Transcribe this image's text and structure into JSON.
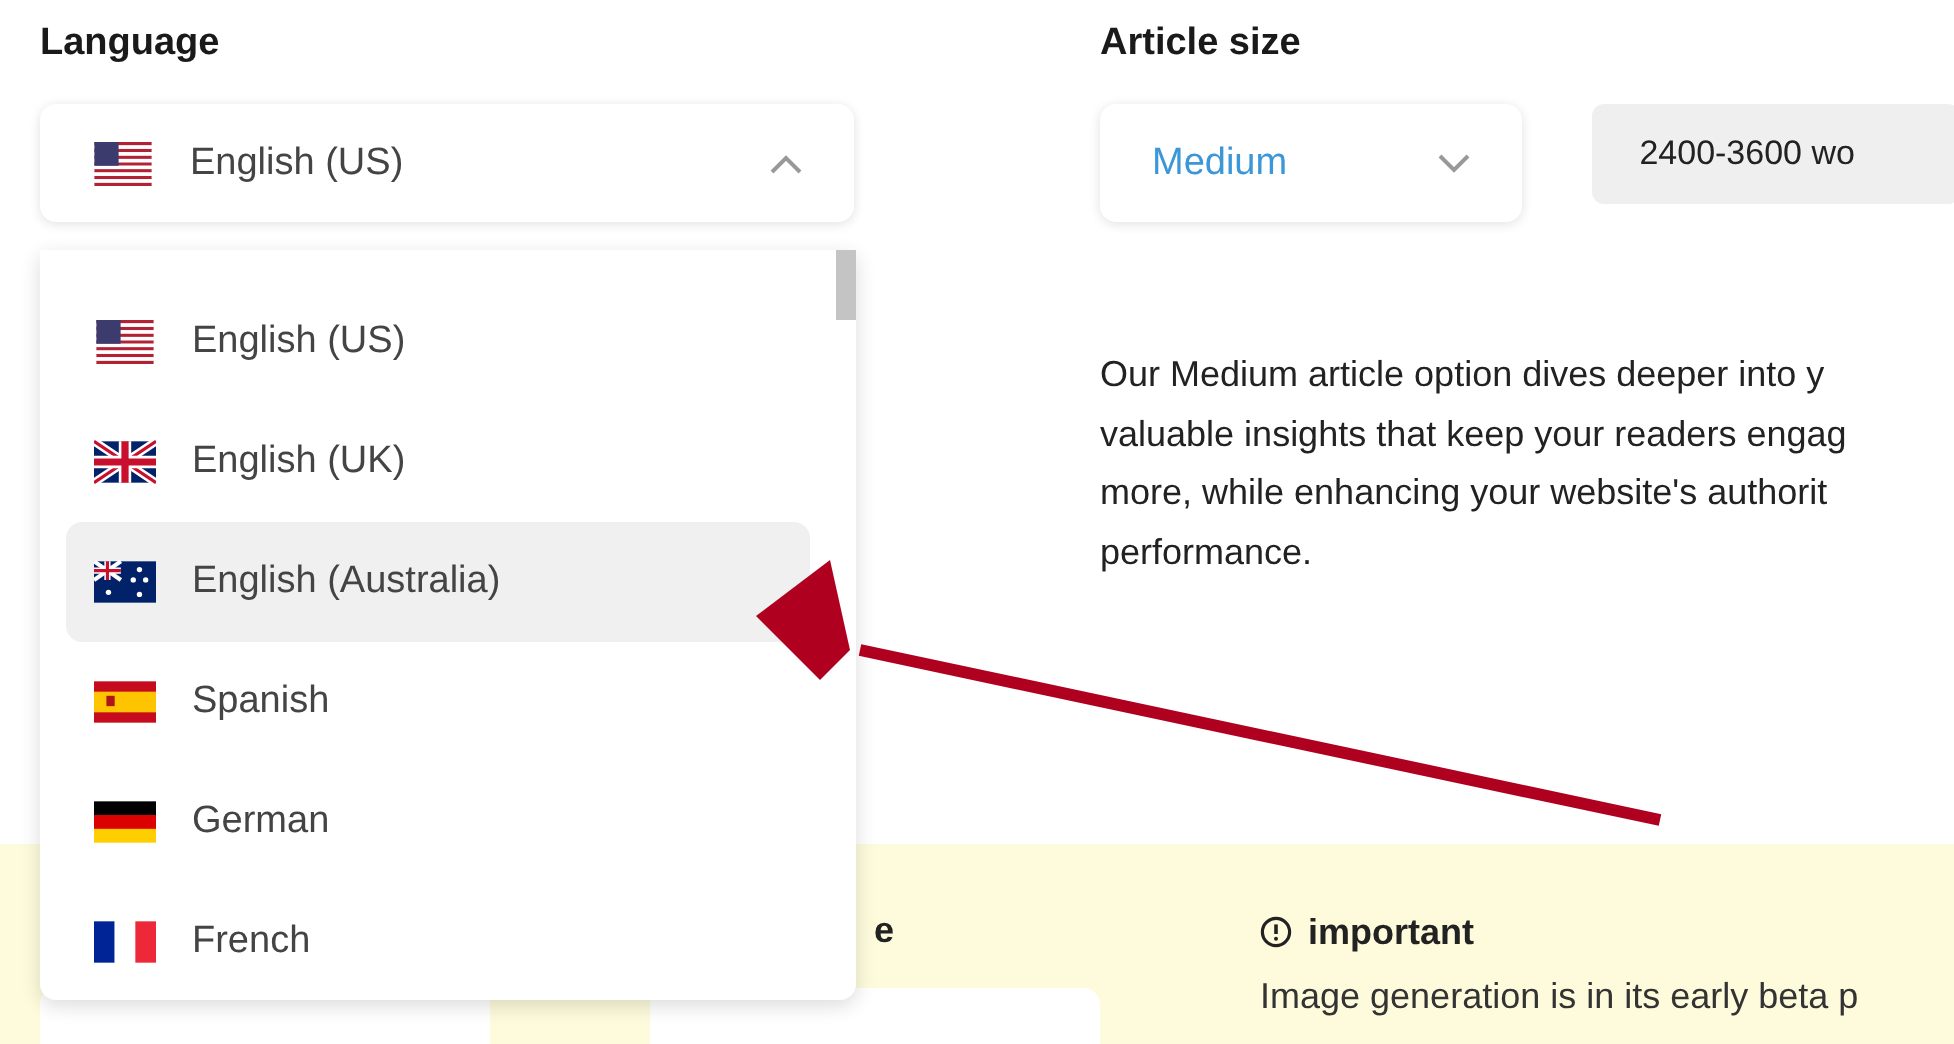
{
  "language": {
    "label": "Language",
    "value": "English (US)",
    "expanded": true
  },
  "language_menu": [
    {
      "label": "English (US)",
      "selected": false
    },
    {
      "label": "English (UK)",
      "selected": false
    },
    {
      "label": "English (Australia)",
      "selected": true
    },
    {
      "label": "Spanish",
      "selected": false
    },
    {
      "label": "German",
      "selected": false
    },
    {
      "label": "French",
      "selected": false
    }
  ],
  "article_size": {
    "label": "Article size",
    "value": "Medium",
    "words": "2400-3600 wo"
  },
  "description": [
    "Our Medium article option dives deeper into y",
    "valuable insights that keep your readers engag",
    "more, while enhancing your website's authorit",
    "performance."
  ],
  "images": {
    "column_2_label": "e",
    "notice_title": "important",
    "notice_text": "Image generation is in its early beta p"
  }
}
